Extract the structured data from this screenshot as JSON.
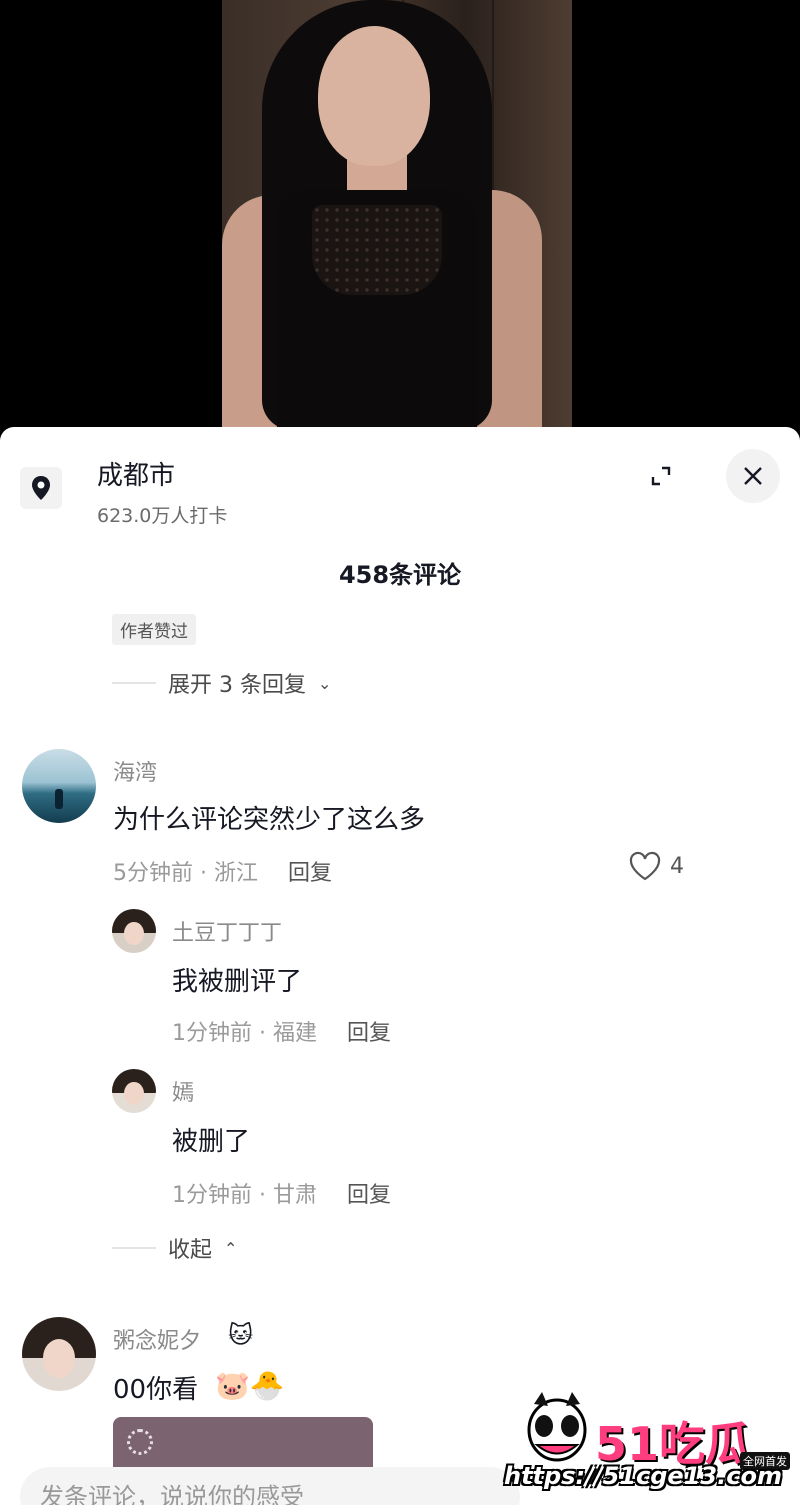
{
  "location": {
    "name": "成都市",
    "checkins": "623.0万人打卡"
  },
  "comments_header": {
    "count_label": "458条评论"
  },
  "thread1": {
    "author_liked_tag": "作者赞过",
    "expand_replies": "展开 3 条回复"
  },
  "comment_main": {
    "username": "海湾",
    "text": "为什么评论突然少了这么多",
    "time_location": "5分钟前 · 浙江",
    "reply_label": "回复",
    "likes": "4"
  },
  "replies": [
    {
      "username": "土豆丁丁丁",
      "text": "我被删评了",
      "time_location": "1分钟前 · 福建",
      "reply_label": "回复"
    },
    {
      "username": "嫣",
      "text": "被删了",
      "time_location": "1分钟前 · 甘肃",
      "reply_label": "回复"
    }
  ],
  "collapse_label": "收起",
  "comment_next": {
    "username": "粥念妮夕",
    "text": "00你看"
  },
  "input": {
    "placeholder": "发条评论，说说你的感受"
  },
  "watermark": {
    "logo": "51吃瓜",
    "badge": "全网首发",
    "url": "https://51cge13.com"
  },
  "colors": {
    "accent": "#ff3d7f",
    "text": "#161823",
    "muted": "#9a9a9a"
  }
}
